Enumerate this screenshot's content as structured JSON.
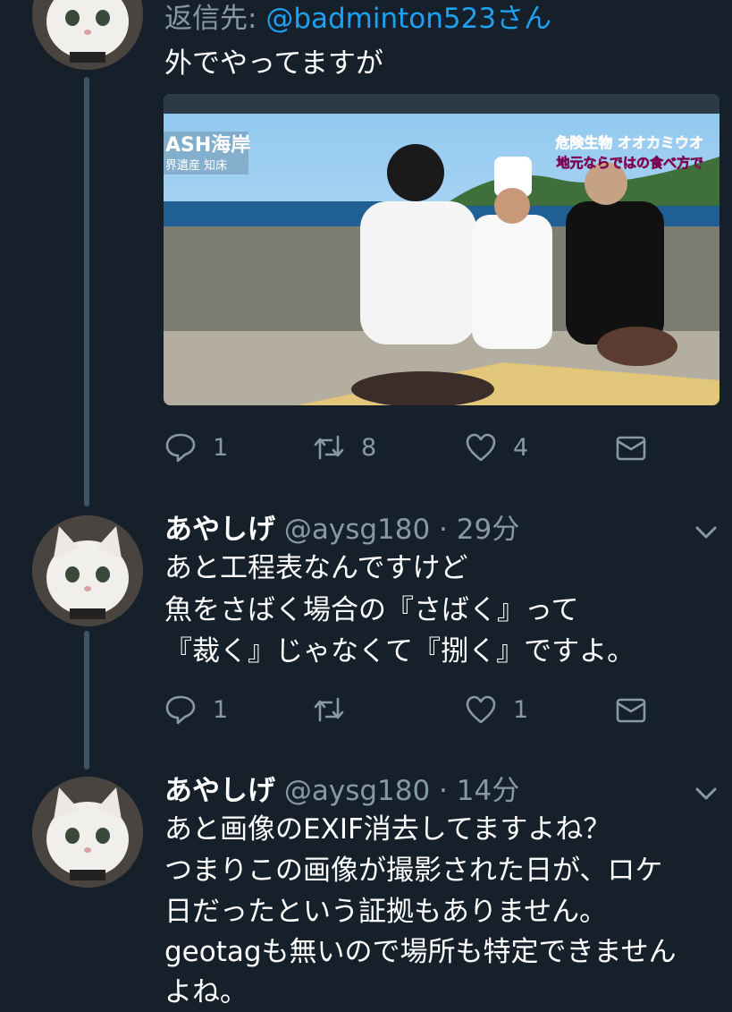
{
  "tweet1": {
    "reply_prefix": "返信先: ",
    "reply_mention": "@badminton523さん",
    "body": "外でやってますが",
    "media": {
      "overlay_left_line1": "ASH海岸",
      "overlay_left_line2": "界遺産 知床",
      "overlay_right_line1": "危険生物 オオカミウオ",
      "overlay_right_line2": "地元ならではの食べ方で"
    },
    "actions": {
      "reply_count": "1",
      "retweet_count": "8",
      "like_count": "4"
    }
  },
  "tweet2": {
    "display_name": "あやしげ",
    "handle": "@aysg180",
    "separator": " · ",
    "time": "29分",
    "lines": [
      "あと工程表なんですけど",
      "魚をさばく場合の『さばく』って",
      "『裁く』じゃなくて『捌く』ですよ。"
    ],
    "actions": {
      "reply_count": "1",
      "retweet_count": "",
      "like_count": "1"
    }
  },
  "tweet3": {
    "display_name": "あやしげ",
    "handle": "@aysg180",
    "separator": " · ",
    "time": "14分",
    "lines": [
      "あと画像のEXIF消去してますよね？",
      "つまりこの画像が撮影された日が、ロケ",
      "日だったという証拠もありません。",
      "geotagも無いので場所も特定できません",
      "よね。"
    ]
  },
  "icons": {
    "reply": "reply-icon",
    "retweet": "retweet-icon",
    "like": "heart-icon",
    "dm": "share-icon",
    "caret": "chevron-down-icon"
  },
  "colors": {
    "background": "#15202b",
    "secondary_text": "#8899a6",
    "mention": "#1da1f2",
    "thread_line": "#3d5466"
  }
}
